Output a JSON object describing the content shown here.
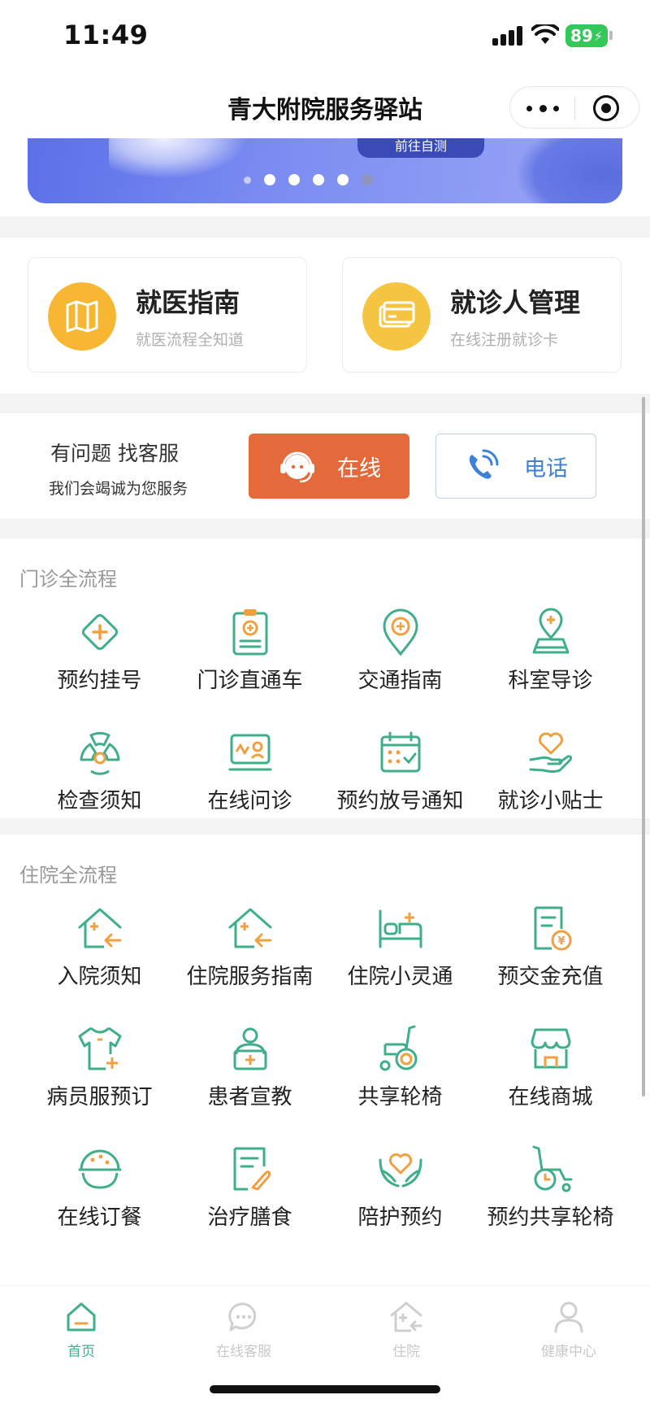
{
  "status_bar": {
    "time": "11:49",
    "battery": "89"
  },
  "nav": {
    "title": "青大附院服务驿站"
  },
  "banner": {
    "button_text": "前往自测"
  },
  "cards": [
    {
      "title": "就医指南",
      "subtitle": "就医流程全知道",
      "icon": "map-icon",
      "color": "#f7b733"
    },
    {
      "title": "就诊人管理",
      "subtitle": "在线注册就诊卡",
      "icon": "card-icon",
      "color": "#f5c542"
    }
  ],
  "service": {
    "title": "有问题 找客服",
    "subtitle": "我们会竭诚为您服务",
    "online_label": "在线",
    "phone_label": "电话"
  },
  "outpatient": {
    "label": "门诊全流程",
    "items": [
      {
        "label": "预约挂号",
        "icon": "diamond-plus-icon"
      },
      {
        "label": "门诊直通车",
        "icon": "clipboard-icon"
      },
      {
        "label": "交通指南",
        "icon": "location-icon"
      },
      {
        "label": "科室导诊",
        "icon": "person-map-icon"
      },
      {
        "label": "检查须知",
        "icon": "radiation-icon"
      },
      {
        "label": "在线问诊",
        "icon": "monitor-icon"
      },
      {
        "label": "预约放号通知",
        "icon": "calendar-icon"
      },
      {
        "label": "就诊小贴士",
        "icon": "heart-hand-icon"
      }
    ]
  },
  "inpatient": {
    "label": "住院全流程",
    "items": [
      {
        "label": "入院须知",
        "icon": "house-arrow-icon"
      },
      {
        "label": "住院服务指南",
        "icon": "house-arrow-icon"
      },
      {
        "label": "住院小灵通",
        "icon": "bed-icon"
      },
      {
        "label": "预交金充值",
        "icon": "bill-icon"
      },
      {
        "label": "病员服预订",
        "icon": "shirt-icon"
      },
      {
        "label": "患者宣教",
        "icon": "patient-icon"
      },
      {
        "label": "共享轮椅",
        "icon": "wheelchair-icon"
      },
      {
        "label": "在线商城",
        "icon": "shop-icon"
      },
      {
        "label": "在线订餐",
        "icon": "meal-icon"
      },
      {
        "label": "治疗膳食",
        "icon": "diet-icon"
      },
      {
        "label": "陪护预约",
        "icon": "care-icon"
      },
      {
        "label": "预约共享轮椅",
        "icon": "wheelchair-clock-icon"
      }
    ]
  },
  "tabs": [
    {
      "label": "首页",
      "icon": "home-icon",
      "active": true
    },
    {
      "label": "在线客服",
      "icon": "chat-icon",
      "active": false
    },
    {
      "label": "住院",
      "icon": "hospital-icon",
      "active": false
    },
    {
      "label": "健康中心",
      "icon": "user-icon",
      "active": false
    }
  ],
  "colors": {
    "green": "#3fae8a",
    "orange": "#f0a040",
    "online_button": "#e56a3b",
    "phone_text": "#3d82d6"
  }
}
